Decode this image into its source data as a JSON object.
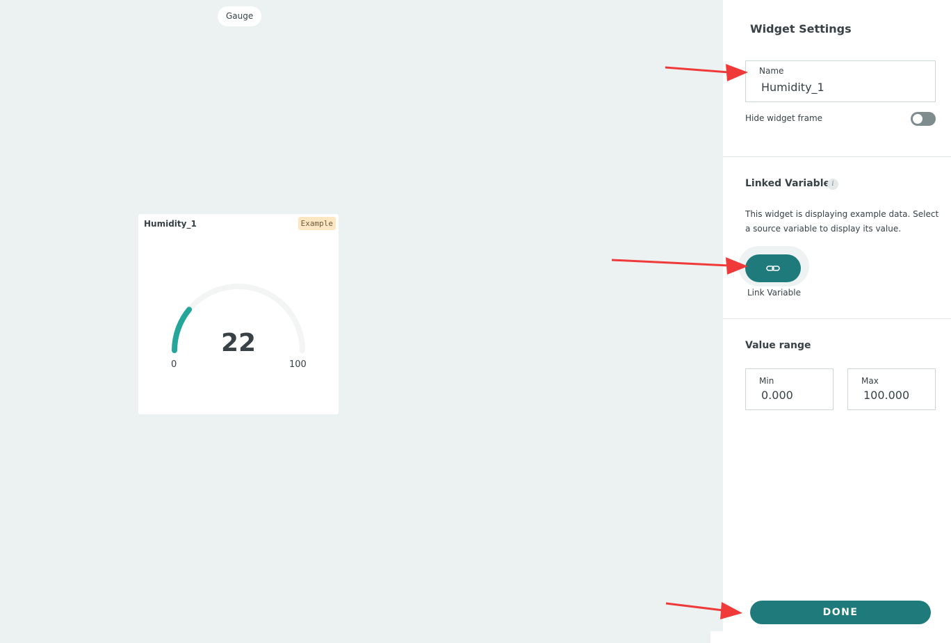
{
  "canvas": {
    "widget_type_label": "Gauge",
    "widget": {
      "title": "Humidity_1",
      "badge": "Example",
      "value": "22",
      "min_label": "0",
      "max_label": "100",
      "fill_fraction": 0.22,
      "accent_color": "#26a69a",
      "track_color": "#f3f4f4"
    }
  },
  "panel": {
    "title": "Widget Settings",
    "name_field": {
      "label": "Name",
      "value": "Humidity_1"
    },
    "hide_frame": {
      "label": "Hide widget frame",
      "enabled": false
    },
    "linked_variable": {
      "title": "Linked Variable",
      "info_icon": "info-icon",
      "description": "This widget is displaying example data. Select a source variable to display its value.",
      "button_icon": "link-icon",
      "button_label": "Link Variable"
    },
    "value_range": {
      "title": "Value range",
      "min": {
        "label": "Min",
        "value": "0.000"
      },
      "max": {
        "label": "Max",
        "value": "100.000"
      }
    },
    "done_label": "DONE",
    "primary_color": "#1f7b7b"
  },
  "annotation_arrow_color": "#f03a3a"
}
